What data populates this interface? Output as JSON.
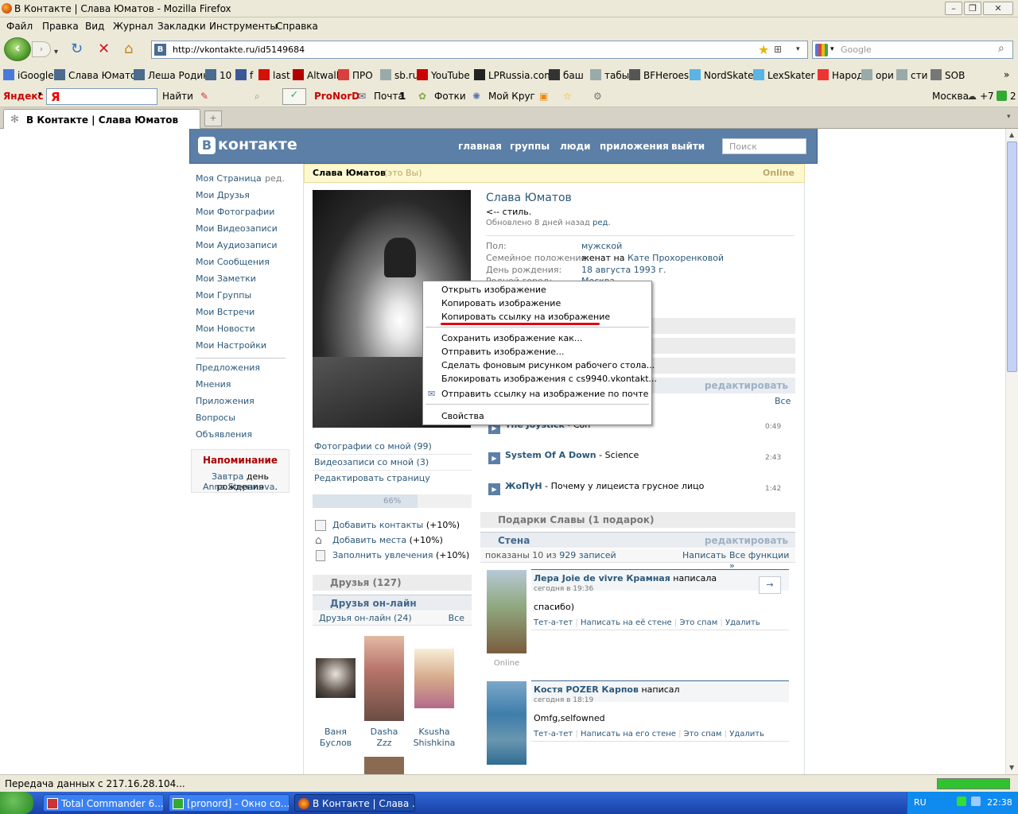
{
  "window": {
    "title": "В Контакте | Слава Юматов - Mozilla Firefox"
  },
  "menu": [
    "Файл",
    "Правка",
    "Вид",
    "Журнал",
    "Закладки",
    "Инструменты",
    "Справка"
  ],
  "address": {
    "url": "http://vkontakte.ru/id5149684",
    "fav": "B"
  },
  "search": {
    "placeholder": "Google"
  },
  "bookmarks": [
    {
      "label": "iGoogle",
      "icon": "google-icon",
      "color": "#4a7ad9"
    },
    {
      "label": "Слава Юматов",
      "icon": "vk-icon",
      "color": "#4b6b8f"
    },
    {
      "label": "Леша Родин",
      "icon": "vk-icon",
      "color": "#4b6b8f"
    },
    {
      "label": "10",
      "icon": "vk-icon",
      "color": "#4b6b8f"
    },
    {
      "label": "f",
      "icon": "facebook-icon",
      "color": "#3b5998"
    },
    {
      "label": "last",
      "icon": "lastfm-icon",
      "color": "#d51007"
    },
    {
      "label": "Altwall",
      "icon": "altwall-icon",
      "color": "#b30000"
    },
    {
      "label": "ПРО",
      "icon": "pro-icon",
      "color": "#d84040"
    },
    {
      "label": "sb.ru",
      "icon": "page-icon",
      "color": "#9aa"
    },
    {
      "label": "YouTube",
      "icon": "youtube-icon",
      "color": "#c00"
    },
    {
      "label": "LPRussia.com",
      "icon": "lp-icon",
      "color": "#222"
    },
    {
      "label": "баш",
      "icon": "bash-icon",
      "color": "#333"
    },
    {
      "label": "табы",
      "icon": "page-icon",
      "color": "#9aa"
    },
    {
      "label": "BFHeroes",
      "icon": "bf-icon",
      "color": "#555"
    },
    {
      "label": "NordSkater",
      "icon": "twitter-icon",
      "color": "#5ab4e6"
    },
    {
      "label": "LexSkater",
      "icon": "twitter-icon",
      "color": "#5ab4e6"
    },
    {
      "label": "Народ",
      "icon": "narod-icon",
      "color": "#e33"
    },
    {
      "label": "ори",
      "icon": "page-icon",
      "color": "#9aa"
    },
    {
      "label": "сти",
      "icon": "page-icon",
      "color": "#9aa"
    },
    {
      "label": "SOB",
      "icon": "sob-icon",
      "color": "#777"
    }
  ],
  "yabar": {
    "brand": "Яндекс",
    "find": "Найти",
    "pronord": "ProNorD",
    "mail": "Почта",
    "mail_count": "1",
    "photos": "Фотки",
    "circle": "Мой Круг",
    "city": "Москва",
    "temp": "+7",
    "count": "2"
  },
  "tab": {
    "label": "В Контакте | Слава Юматов",
    "newtab": "+"
  },
  "status": {
    "text": "Передача данных с 217.16.28.104..."
  },
  "taskbar": {
    "tasks": [
      "Total Commander 6....",
      "[pronord] - Окно со...",
      "В Контакте | Слава ..."
    ],
    "lang": "RU",
    "time": "22:38"
  },
  "vk": {
    "logo": "контакте",
    "nav": [
      "главная",
      "группы",
      "люди",
      "приложения",
      "выйти"
    ],
    "search_placeholder": "Поиск",
    "left_menu": [
      "Моя Страница",
      "Мои Друзья",
      "Мои Фотографии",
      "Мои Видеозаписи",
      "Мои Аудиозаписи",
      "Мои Сообщения",
      "Мои Заметки",
      "Мои Группы",
      "Мои Встречи",
      "Мои Новости",
      "Мои Настройки"
    ],
    "edit_link": "ред.",
    "left_menu2": [
      "Предложения",
      "Мнения",
      "Приложения",
      "Вопросы",
      "Объявления"
    ],
    "reminder": {
      "title": "Напоминание",
      "line1": "Завтра",
      "line1b": "день рождения",
      "line2": "Anna Stepanova",
      "line2b": "."
    },
    "profile": {
      "name_bar": "Слава Юматов",
      "you": "(это Вы)",
      "online": "Online",
      "name": "Слава Юматов",
      "status": "<-- стиль.",
      "updated": "Обновлено 8 дней назад",
      "updated_edit": "ред.",
      "fields": [
        {
          "k": "Пол:",
          "v": "мужской"
        },
        {
          "k": "Семейное положение:",
          "v": "женат на",
          "v2": "Кате Прохоренковой"
        },
        {
          "k": "День рождения:",
          "v": "18 августа 1993 г."
        }
      ],
      "partial": "Родной город:",
      "partial_v": "Москва"
    },
    "photo_links": [
      "Фотографии со мной (99)",
      "Видеозаписи со мной (3)",
      "Редактировать страницу"
    ],
    "completion": "66%",
    "completion_value": 0.66,
    "add_items": [
      {
        "l": "Добавить контакты",
        "p": "(+10%)"
      },
      {
        "l": "Добавить места",
        "p": "(+10%)"
      },
      {
        "l": "Заполнить увлечения",
        "p": "(+10%)"
      }
    ],
    "friends": {
      "title": "Друзья (127)",
      "online_title": "Друзья он-лайн",
      "online_count": "Друзья он-лайн (24)",
      "all": "Все",
      "list": [
        {
          "n1": "Ваня",
          "n2": "Буслов"
        },
        {
          "n1": "Dasha",
          "n2": "Zzz"
        },
        {
          "n1": "Ksusha",
          "n2": "Shishkina"
        }
      ]
    },
    "audio": {
      "edit": "редактировать",
      "all": "Все",
      "songs": [
        {
          "a": "The Joystick",
          "t": "Con",
          "d": "0:49"
        },
        {
          "a": "System Of A Down",
          "t": "Science",
          "d": "2:43"
        },
        {
          "a": "ЖоПуН",
          "t": "Почему у лицеиста грусное лицо",
          "d": "1:42"
        }
      ]
    },
    "gifts": "Подарки Славы (1 подарок)",
    "wall": {
      "title": "Стена",
      "edit": "редактировать",
      "shown": "показаны 10 из",
      "count": "929 записей",
      "write": "Написать",
      "all_funcs": "Все функции »",
      "posts": [
        {
          "author": "Лера Joie de vivre Крамная",
          "verb": "написала",
          "date": "сегодня в 19:36",
          "text": "спасибо)",
          "actions": [
            "Тет-а-тет",
            "Написать на её стене",
            "Это спам",
            "Удалить"
          ],
          "online": "Online"
        },
        {
          "author": "Костя POZER Карпов",
          "verb": "написал",
          "date": "сегодня в 18:19",
          "text": "Omfg,selfowned",
          "actions": [
            "Тет-а-тет",
            "Написать на его стене",
            "Это спам",
            "Удалить"
          ],
          "online": ""
        }
      ]
    }
  },
  "context_menu": {
    "items": [
      "Открыть изображение",
      "Копировать изображение",
      "Копировать ссылку на изображение",
      "Сохранить изображение как...",
      "Отправить изображение...",
      "Сделать фоновым рисунком рабочего стола...",
      "Блокировать изображения с cs9940.vkontakt...",
      "Отправить ссылку на изображение по почте",
      "Свойства"
    ]
  }
}
